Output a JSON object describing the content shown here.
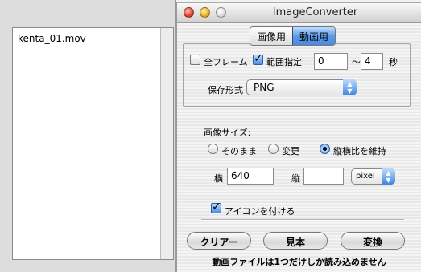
{
  "file_list": {
    "items": [
      "kenta_01.mov"
    ]
  },
  "window": {
    "title": "ImageConverter"
  },
  "tabs": [
    {
      "label": "画像用",
      "active": false
    },
    {
      "label": "動画用",
      "active": true
    }
  ],
  "frames": {
    "all_frames_label": "全フレーム",
    "all_frames_checked": false,
    "range_label": "範囲指定",
    "range_checked": true,
    "range_start": "0",
    "range_separator": "〜",
    "range_end": "4",
    "range_unit": "秒"
  },
  "save_format": {
    "label": "保存形式",
    "selected": "PNG"
  },
  "image_size": {
    "heading": "画像サイズ:",
    "options": [
      {
        "label": "そのまま",
        "selected": false
      },
      {
        "label": "変更",
        "selected": false
      },
      {
        "label": "縦横比を維持",
        "selected": true
      }
    ],
    "width_label": "横",
    "width_value": "640",
    "height_label": "縦",
    "height_value": "",
    "unit": "pixel"
  },
  "icon_option": {
    "label": "アイコンを付ける",
    "checked": true
  },
  "buttons": {
    "clear": "クリアー",
    "sample": "見本",
    "convert": "変換"
  },
  "status": "動画ファイルは1つだけしか読み込めません",
  "colors": {
    "accent": "#4c8fe3",
    "window_bg": "#f2f2f2"
  }
}
